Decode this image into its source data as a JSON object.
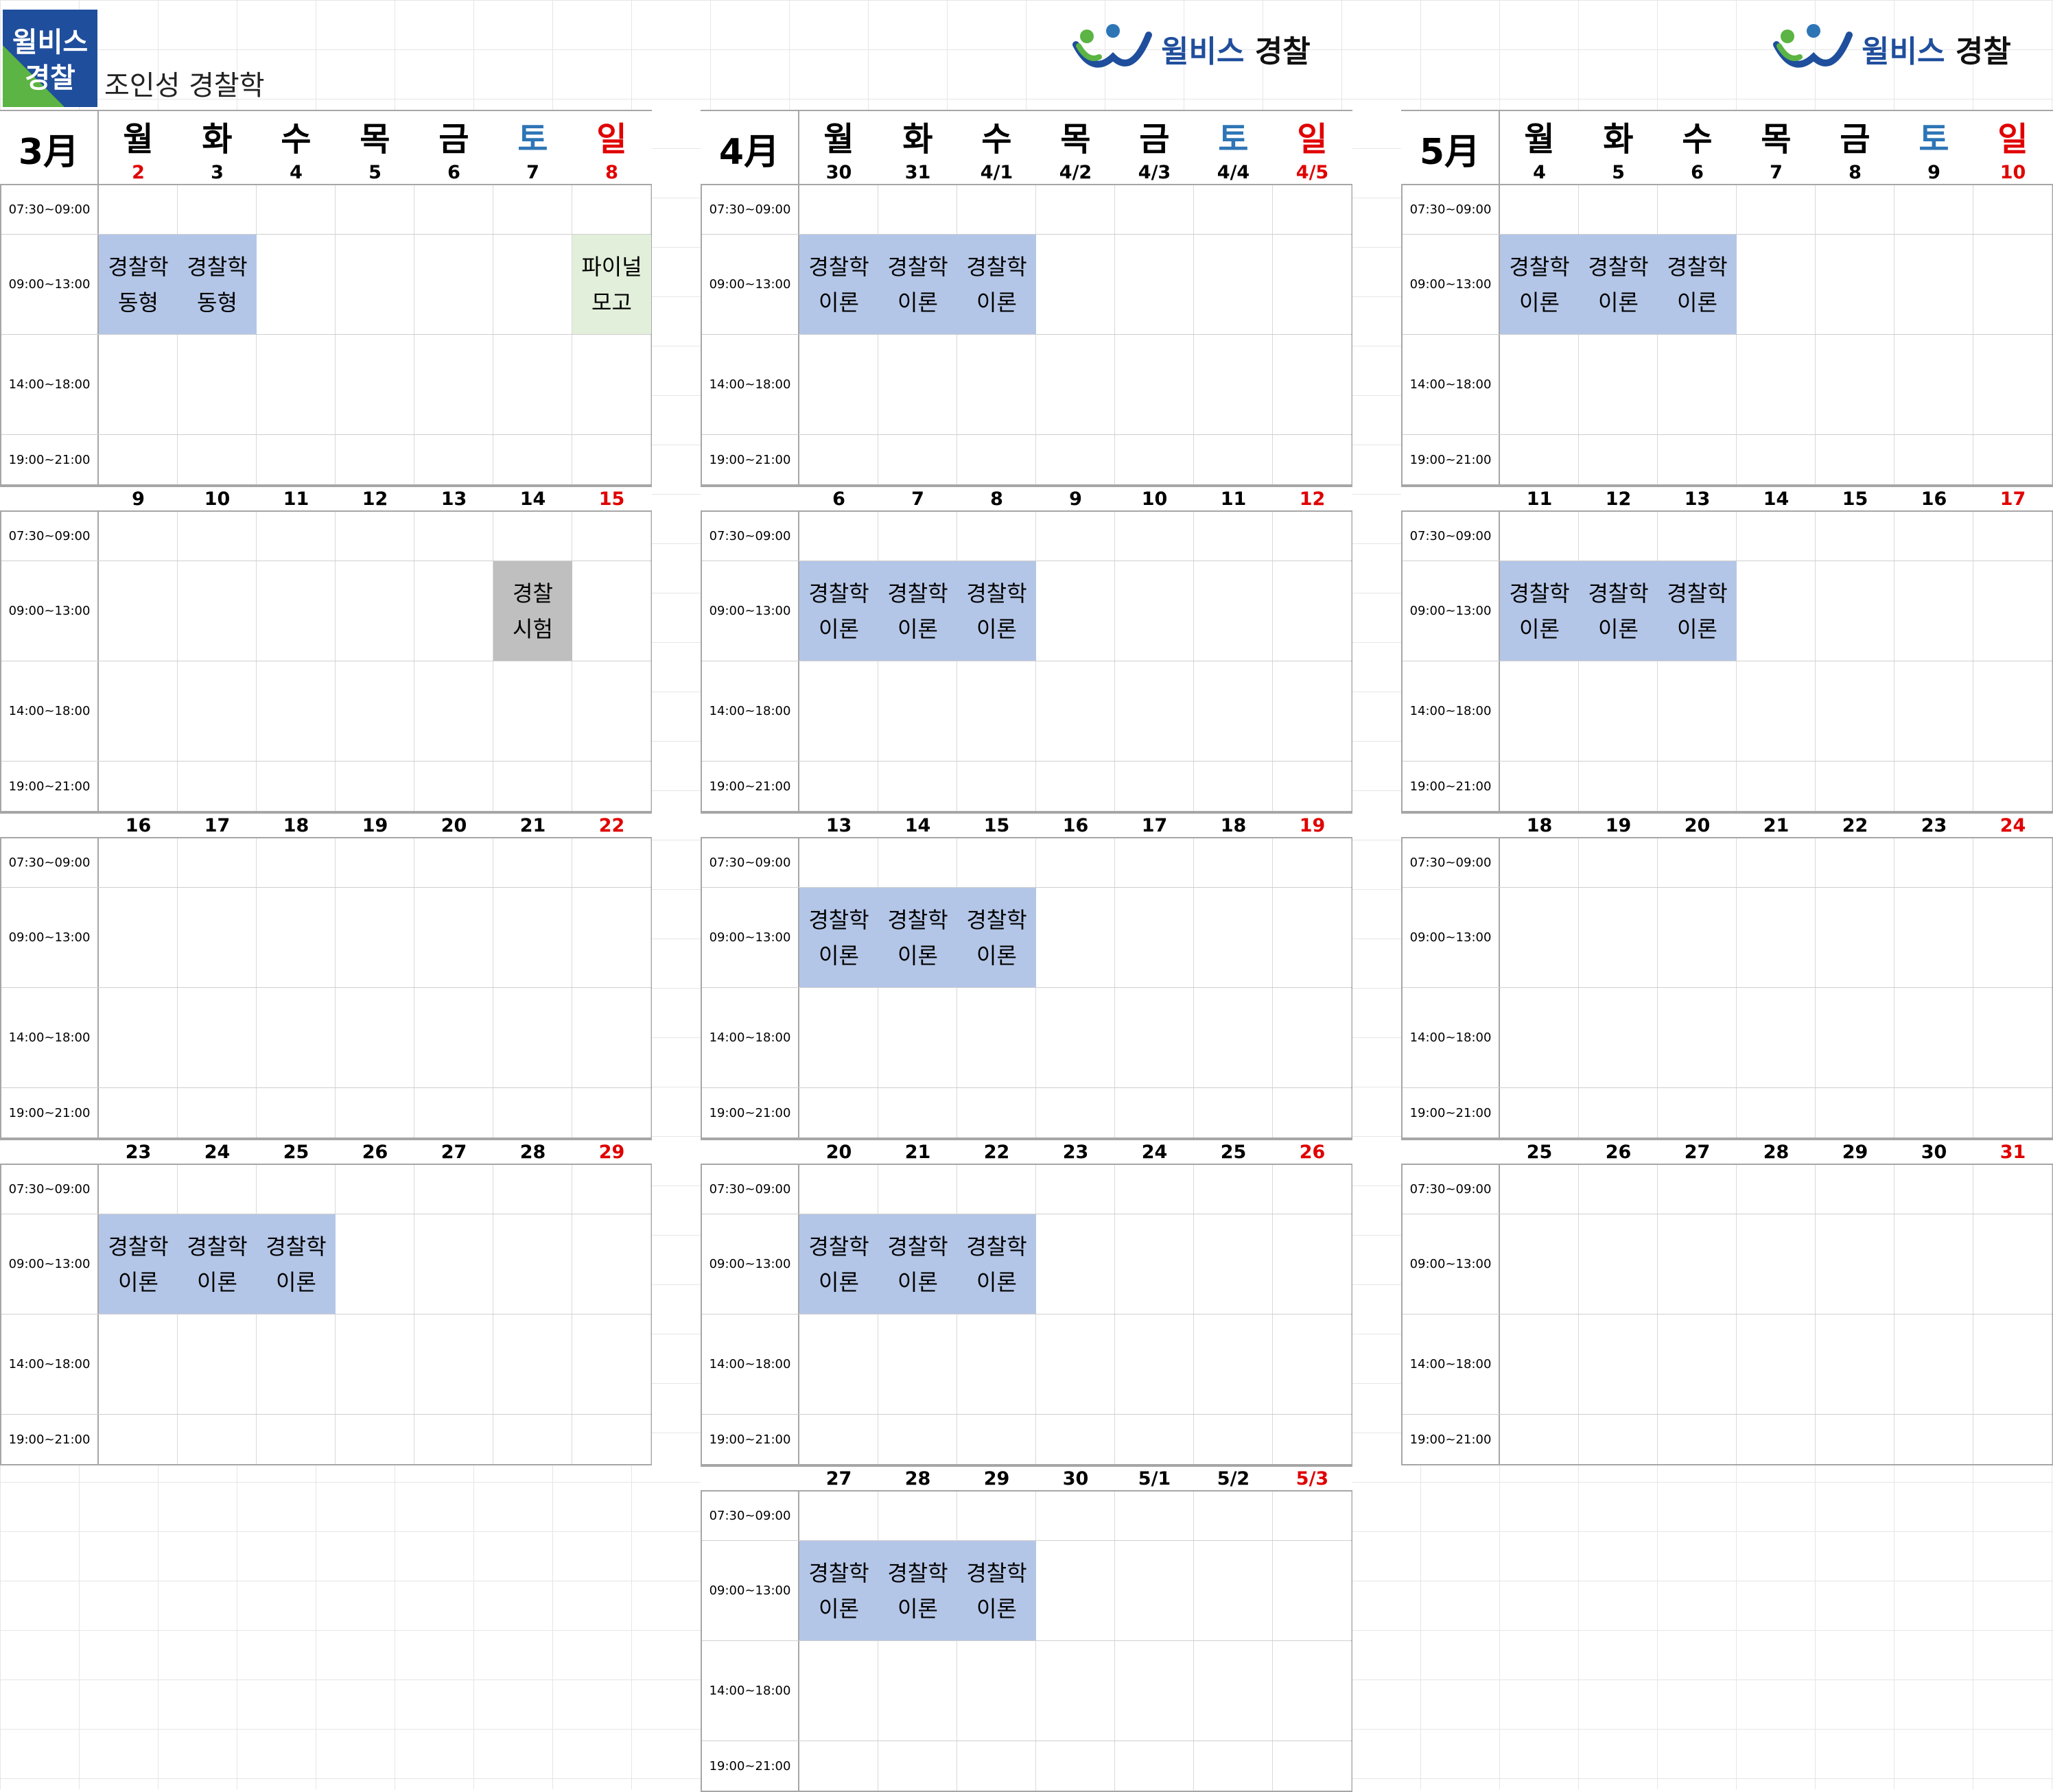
{
  "header": {
    "logo_line1": "윌비스",
    "logo_line2": "경찰",
    "subtitle": "조인성 경찰학",
    "brand_a": "윌비스",
    "brand_b": "경찰"
  },
  "weekdays": [
    "월",
    "화",
    "수",
    "목",
    "금",
    "토",
    "일"
  ],
  "time_slots": [
    "07:30~09:00",
    "09:00~13:00",
    "14:00~18:00",
    "19:00~21:00"
  ],
  "colors": {
    "lecture": "#b4c6e7",
    "mock": "#e2efda",
    "exam": "#bfbfbf",
    "saturday": "#2e75b6",
    "sunday": "#e00000"
  },
  "months": [
    {
      "label": "3月",
      "weeks": [
        {
          "days": [
            "2",
            "3",
            "4",
            "5",
            "6",
            "7",
            "8"
          ],
          "events": [
            {
              "col": 0,
              "text": "경찰학\n동형",
              "kind": "blue"
            },
            {
              "col": 1,
              "text": "경찰학\n동형",
              "kind": "blue"
            },
            {
              "col": 6,
              "text": "파이널\n모고",
              "kind": "green"
            }
          ]
        },
        {
          "days": [
            "9",
            "10",
            "11",
            "12",
            "13",
            "14",
            "15"
          ],
          "events": [
            {
              "col": 5,
              "text": "경찰\n시험",
              "kind": "gray"
            }
          ]
        },
        {
          "days": [
            "16",
            "17",
            "18",
            "19",
            "20",
            "21",
            "22"
          ],
          "events": []
        },
        {
          "days": [
            "23",
            "24",
            "25",
            "26",
            "27",
            "28",
            "29"
          ],
          "events": [
            {
              "col": 0,
              "text": "경찰학\n이론",
              "kind": "blue"
            },
            {
              "col": 1,
              "text": "경찰학\n이론",
              "kind": "blue"
            },
            {
              "col": 2,
              "text": "경찰학\n이론",
              "kind": "blue"
            }
          ]
        }
      ]
    },
    {
      "label": "4月",
      "weeks": [
        {
          "days": [
            "30",
            "31",
            "4/1",
            "4/2",
            "4/3",
            "4/4",
            "4/5"
          ],
          "events": [
            {
              "col": 0,
              "text": "경찰학\n이론",
              "kind": "blue"
            },
            {
              "col": 1,
              "text": "경찰학\n이론",
              "kind": "blue"
            },
            {
              "col": 2,
              "text": "경찰학\n이론",
              "kind": "blue"
            }
          ]
        },
        {
          "days": [
            "6",
            "7",
            "8",
            "9",
            "10",
            "11",
            "12"
          ],
          "events": [
            {
              "col": 0,
              "text": "경찰학\n이론",
              "kind": "blue"
            },
            {
              "col": 1,
              "text": "경찰학\n이론",
              "kind": "blue"
            },
            {
              "col": 2,
              "text": "경찰학\n이론",
              "kind": "blue"
            }
          ]
        },
        {
          "days": [
            "13",
            "14",
            "15",
            "16",
            "17",
            "18",
            "19"
          ],
          "events": [
            {
              "col": 0,
              "text": "경찰학\n이론",
              "kind": "blue"
            },
            {
              "col": 1,
              "text": "경찰학\n이론",
              "kind": "blue"
            },
            {
              "col": 2,
              "text": "경찰학\n이론",
              "kind": "blue"
            }
          ]
        },
        {
          "days": [
            "20",
            "21",
            "22",
            "23",
            "24",
            "25",
            "26"
          ],
          "events": [
            {
              "col": 0,
              "text": "경찰학\n이론",
              "kind": "blue"
            },
            {
              "col": 1,
              "text": "경찰학\n이론",
              "kind": "blue"
            },
            {
              "col": 2,
              "text": "경찰학\n이론",
              "kind": "blue"
            }
          ]
        },
        {
          "days": [
            "27",
            "28",
            "29",
            "30",
            "5/1",
            "5/2",
            "5/3"
          ],
          "events": [
            {
              "col": 0,
              "text": "경찰학\n이론",
              "kind": "blue"
            },
            {
              "col": 1,
              "text": "경찰학\n이론",
              "kind": "blue"
            },
            {
              "col": 2,
              "text": "경찰학\n이론",
              "kind": "blue"
            }
          ]
        }
      ]
    },
    {
      "label": "5月",
      "weeks": [
        {
          "days": [
            "4",
            "5",
            "6",
            "7",
            "8",
            "9",
            "10"
          ],
          "events": [
            {
              "col": 0,
              "text": "경찰학\n이론",
              "kind": "blue"
            },
            {
              "col": 1,
              "text": "경찰학\n이론",
              "kind": "blue"
            },
            {
              "col": 2,
              "text": "경찰학\n이론",
              "kind": "blue"
            }
          ]
        },
        {
          "days": [
            "11",
            "12",
            "13",
            "14",
            "15",
            "16",
            "17"
          ],
          "events": [
            {
              "col": 0,
              "text": "경찰학\n이론",
              "kind": "blue"
            },
            {
              "col": 1,
              "text": "경찰학\n이론",
              "kind": "blue"
            },
            {
              "col": 2,
              "text": "경찰학\n이론",
              "kind": "blue"
            }
          ]
        },
        {
          "days": [
            "18",
            "19",
            "20",
            "21",
            "22",
            "23",
            "24"
          ],
          "events": []
        },
        {
          "days": [
            "25",
            "26",
            "27",
            "28",
            "29",
            "30",
            "31"
          ],
          "events": []
        }
      ]
    }
  ]
}
